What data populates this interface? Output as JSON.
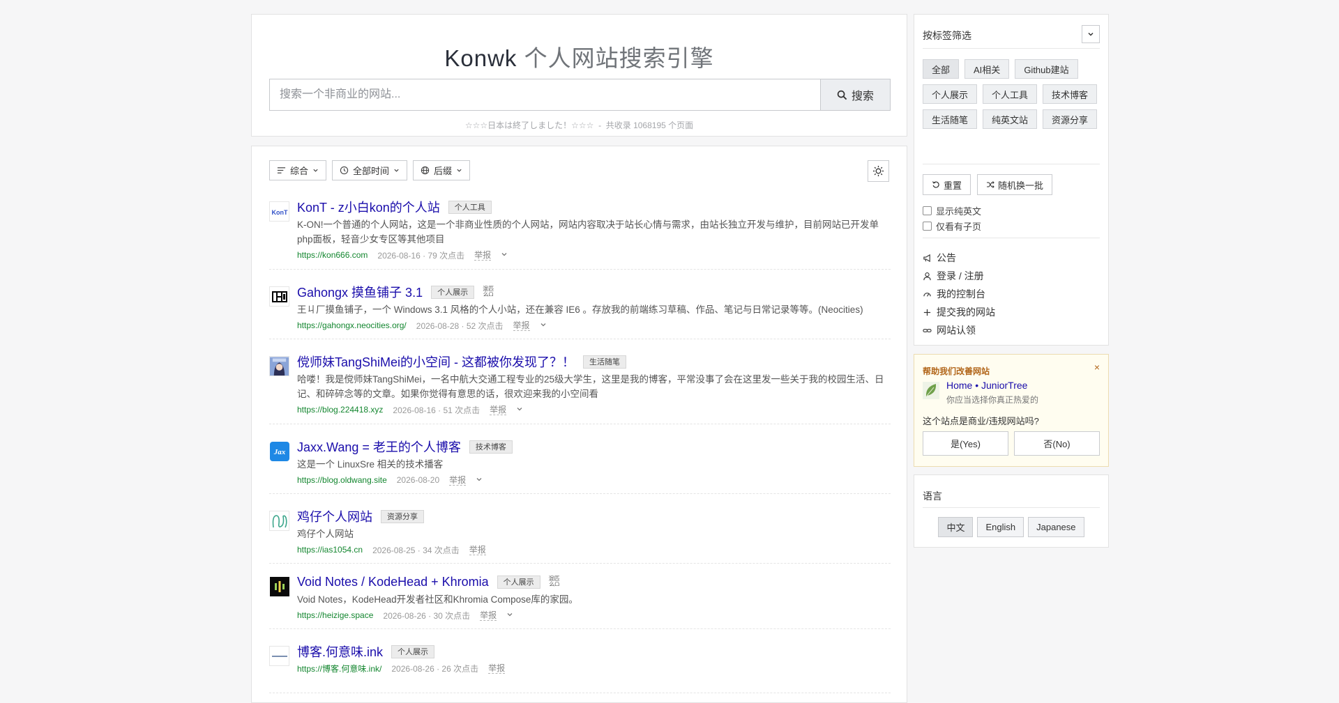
{
  "header": {
    "title_brand": "Konwk",
    "title_sub": "个人网站搜索引擎",
    "search_placeholder": "搜索一个非商业的网站...",
    "search_button": "搜索",
    "notice": "☆☆☆日本は終了しました！☆☆☆",
    "separator": "-",
    "index_count": "共收录 1068195 个页面"
  },
  "toolbar": {
    "sort_label": "综合",
    "time_label": "全部时间",
    "suffix_label": "后缀"
  },
  "results": [
    {
      "title": "KonT - z小白kon的个人站",
      "tag": "个人工具",
      "has_sub_icon": false,
      "desc": "K-ON!一个普通的个人网站，这是一个非商业性质的个人网站，网站内容取决于站长心情与需求，由站长独立开发与维护，目前网站已开发单php面板，轻音少女专区等其他项目",
      "url": "https://kon666.com",
      "meta": "2026-08-16 · 79 次点击",
      "report": "举报",
      "favicon": "kont-logo-icon"
    },
    {
      "title": "Gahongx 摸鱼铺子 3.1",
      "tag": "个人展示",
      "has_sub_icon": true,
      "sub_icon_text": "混匹\n么ᗝ",
      "desc": "王ㄐ厂摸鱼铺子，一个 Windows 3.1 风格的个人小站，还在兼容 IE6 。存放我的前端练习草稿、作品、笔记与日常记录等等。(Neocities)",
      "url": "https://gahongx.neocities.org/",
      "meta": "2026-08-28 · 52 次点击",
      "report": "举报",
      "favicon": "pixel-logo-icon"
    },
    {
      "title": "傥师妹TangShiMei的小空间 - 这都被你发现了？！",
      "tag": "生活随笔",
      "has_sub_icon": false,
      "desc": "哈喽！我是傥师妹TangShiMei，一名中航大交通工程专业的25级大学生，这里是我的博客，平常没事了会在这里发一些关于我的校园生活、日记、和碎碎念等的文章。如果你觉得有意思的话，很欢迎来我的小空间看",
      "url": "https://blog.224418.xyz",
      "meta": "2026-08-16 · 51 次点击",
      "report": "举报",
      "favicon": "anime-avatar-icon"
    },
    {
      "title": "Jaxx.Wang = 老王的个人博客",
      "tag": "技术博客",
      "has_sub_icon": false,
      "desc": "这是一个 LinuxSre 相关的技术播客",
      "url": "https://blog.oldwang.site",
      "meta": "2026-08-20",
      "report": "举报",
      "favicon": "jax-logo-icon"
    },
    {
      "title": "鸡仔个人网站",
      "tag": "资源分享",
      "has_sub_icon": false,
      "desc": "鸡仔个人网站",
      "url": "https://ias1054.cn",
      "meta": "2026-08-25 · 34 次点击",
      "report": "举报",
      "favicon": "swirl-logo-icon"
    },
    {
      "title": "Void Notes / KodeHead + Khromia",
      "tag": "个人展示",
      "has_sub_icon": true,
      "sub_icon_text": "混匹\n么ᗝ",
      "desc": "Void Notes，KodeHead开发者社区和Khromia Compose库的家园。",
      "url": "https://heizige.space",
      "meta": "2026-08-26 · 30 次点击",
      "report": "举报",
      "favicon": "bars-logo-icon"
    },
    {
      "title": "博客.何意味.ink",
      "tag": "个人展示",
      "has_sub_icon": false,
      "desc": "",
      "url": "https://博客.何意味.ink/",
      "meta": "2026-08-26 · 26 次点击",
      "report": "举报",
      "favicon": "tiny-logo-icon"
    }
  ],
  "sidebar": {
    "filter_title": "按标签筛选",
    "tags": [
      "全部",
      "AI相关",
      "Github建站",
      "个人展示",
      "个人工具",
      "技术博客",
      "生活随笔",
      "纯英文站",
      "资源分享"
    ],
    "reset_label": "重置",
    "shuffle_label": "随机换一批",
    "check_english": "显示纯英文",
    "check_subpage": "仅看有子页",
    "links": [
      "公告",
      "登录 / 注册",
      "我的控制台",
      "提交我的网站",
      "网站认领"
    ]
  },
  "help": {
    "title": "帮助我们改善网站",
    "close": "×",
    "site_name": "Home • JuniorTree",
    "site_sub": "你应当选择你真正热爱的",
    "question": "这个站点是商业/违规网站吗?",
    "yes": "是(Yes)",
    "no": "否(No)"
  },
  "language": {
    "title": "语言",
    "options": [
      "中文",
      "English",
      "Japanese"
    ]
  },
  "colors": {
    "title_link": "#1a0dab",
    "url_green": "#13862f",
    "help_accent": "#b2661a"
  }
}
